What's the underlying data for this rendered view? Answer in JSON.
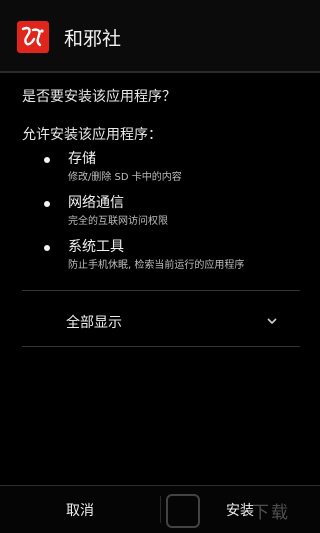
{
  "titlebar": {
    "app_name": "和邪社",
    "app_icon": "app-logo-icon"
  },
  "prompt": {
    "question": "是否要安装该应用程序？",
    "allow_label": "允许安装该应用程序："
  },
  "permissions": [
    {
      "title": "存储",
      "desc": "修改/删除 SD 卡中的内容"
    },
    {
      "title": "网络通信",
      "desc": "完全的互联网访问权限"
    },
    {
      "title": "系统工具",
      "desc": "防止手机休眠, 检索当前运行的应用程序"
    }
  ],
  "show_all": {
    "label": "全部显示",
    "icon": "chevron-down-icon"
  },
  "buttons": {
    "cancel": "取消",
    "install": "安装"
  },
  "watermark": {
    "text": "下载"
  },
  "colors": {
    "background": "#000000",
    "app_icon_red": "#e0251b",
    "text_primary": "#f2f2f2",
    "text_secondary": "#bdbdbd"
  }
}
